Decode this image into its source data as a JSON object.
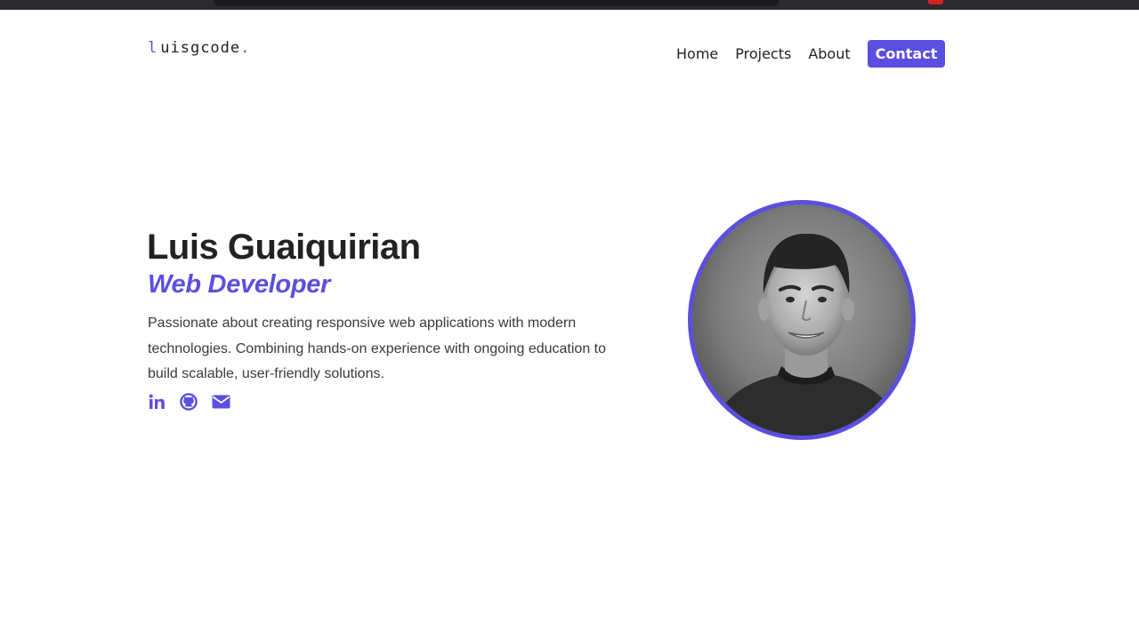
{
  "logo": {
    "prefix": "l",
    "text": "uisgcode",
    "suffix": "."
  },
  "nav": {
    "items": [
      {
        "label": "Home"
      },
      {
        "label": "Projects"
      },
      {
        "label": "About"
      }
    ],
    "cta": "Contact"
  },
  "hero": {
    "name": "Luis Guaiquirian",
    "role": "Web Developer",
    "description": "Passionate about creating responsive web applications with modern technologies. Combining hands-on experience with ongoing education to build scalable, user-friendly solutions."
  },
  "social": [
    {
      "icon": "linkedin-icon"
    },
    {
      "icon": "github-icon"
    },
    {
      "icon": "email-icon"
    }
  ],
  "colors": {
    "accent": "#5b4fe0",
    "text": "#222222",
    "background": "#ffffff"
  }
}
